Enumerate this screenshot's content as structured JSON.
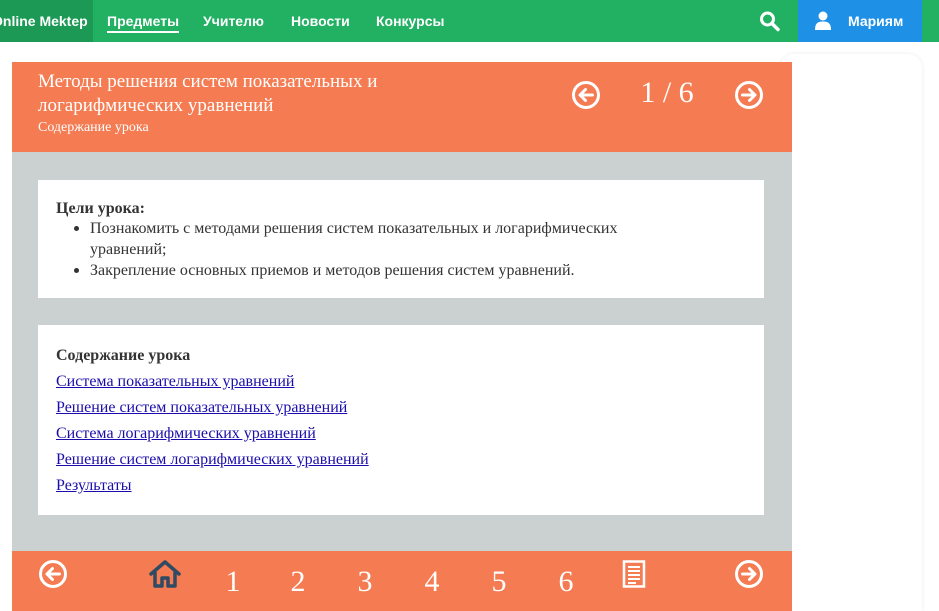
{
  "topbar": {
    "logo_text": "Online Mektep",
    "nav_items": [
      {
        "label": "Предметы",
        "active": true
      },
      {
        "label": "Учителю",
        "active": false
      },
      {
        "label": "Новости",
        "active": false
      },
      {
        "label": "Конкурсы",
        "active": false
      }
    ],
    "search_icon": "search-icon",
    "user_name": "Мариям",
    "user_icon": "user-icon"
  },
  "lesson": {
    "title": "Методы решения систем показательных и логарифмических уравнений",
    "subtitle": "Содержание урока",
    "page_indicator": "1 / 6",
    "prev_icon": "arrow-left-circle-icon",
    "next_icon": "arrow-right-circle-icon"
  },
  "goals": {
    "heading": "Цели урока:",
    "items": [
      "Познакомить с  методами решения систем показательных и логарифмических уравнений;",
      "Закрепление основных приемов и методов решения систем уравнений."
    ]
  },
  "toc": {
    "heading": "Содержание урока",
    "links": [
      "Система показательных уравнений",
      "Решение систем показательных уравнений",
      "Система логарифмических уравнений",
      "Решение систем логарифмических уравнений",
      "Результаты"
    ]
  },
  "footer": {
    "prev_icon": "arrow-left-circle-icon",
    "home_icon": "home-icon",
    "pages": [
      "1",
      "2",
      "3",
      "4",
      "5",
      "6"
    ],
    "results_icon": "document-list-icon",
    "next_icon": "arrow-right-circle-icon"
  },
  "colors": {
    "topbar_green": "#22b063",
    "user_blue": "#1e90e6",
    "lesson_orange": "#f47b52",
    "content_gray": "#cbd0d1",
    "link_blue": "#1a0dab",
    "home_icon": "#2f4a63"
  }
}
